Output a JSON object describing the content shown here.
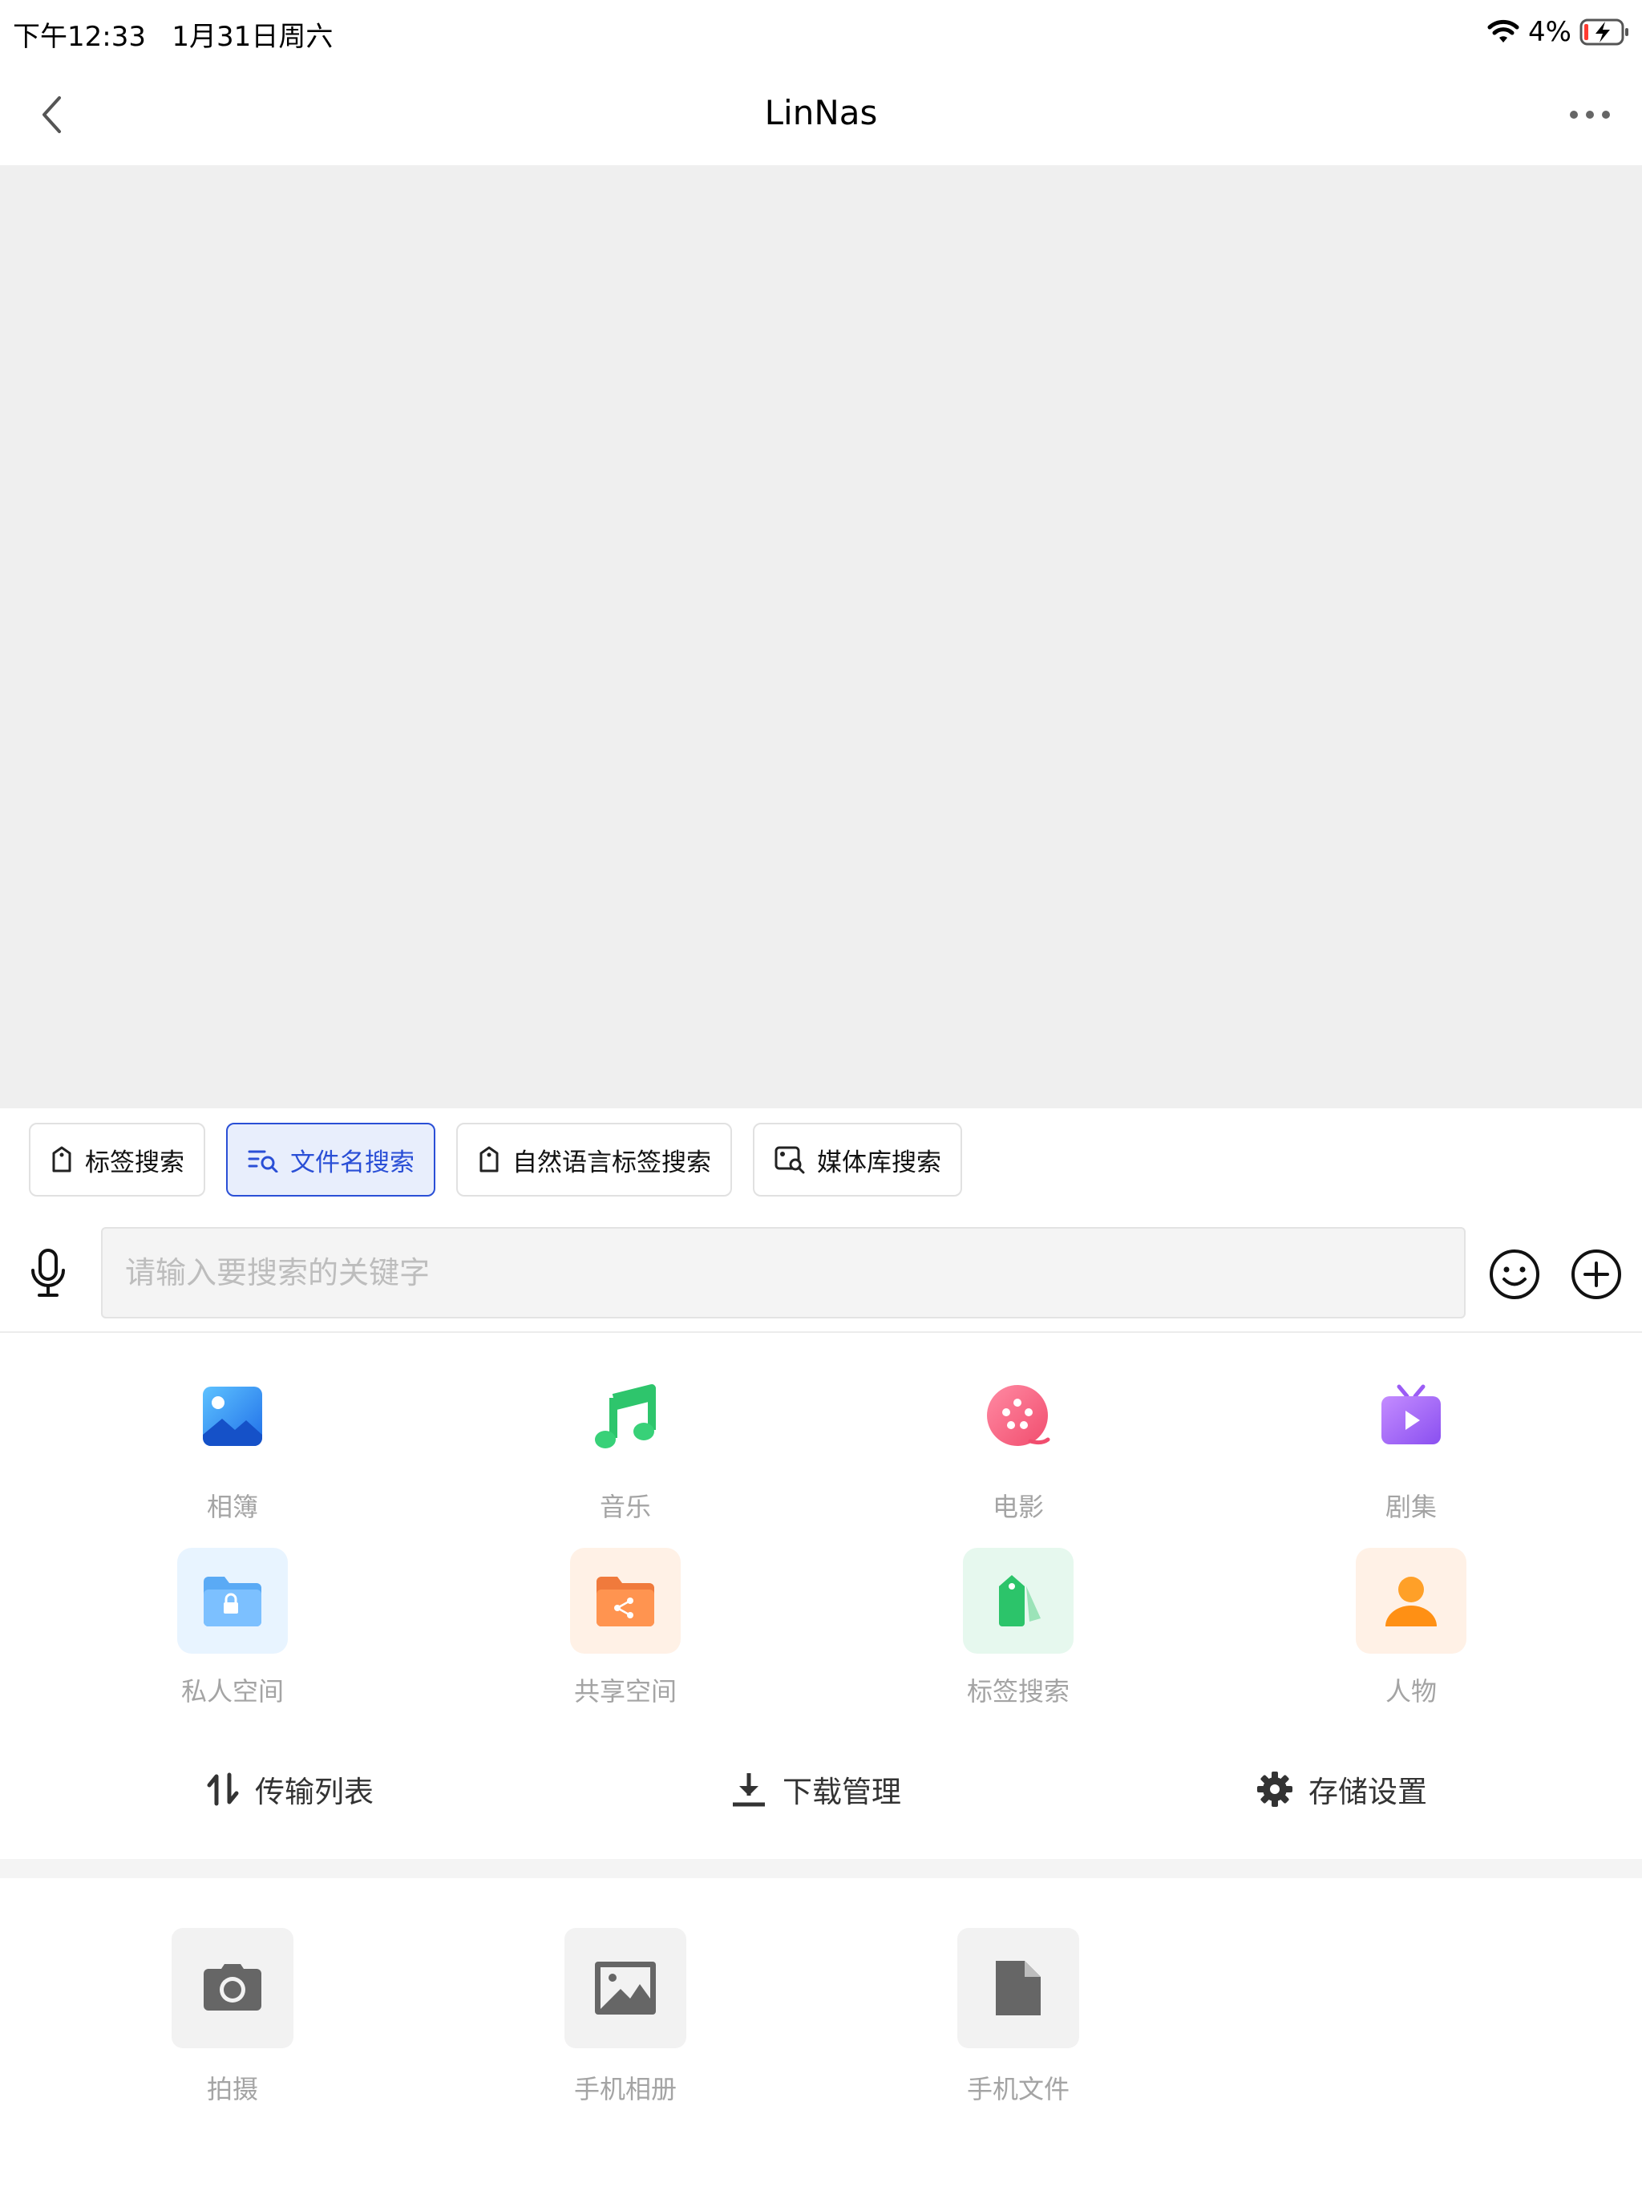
{
  "status_bar": {
    "time": "下午12:33",
    "date": "1月31日周六",
    "battery": "4%",
    "icons": [
      "wifi-icon",
      "battery-charging-icon"
    ]
  },
  "nav": {
    "title": "LinNas",
    "back_icon": "chevron-left-icon",
    "more_icon": "more-dots-icon"
  },
  "search_tabs": [
    {
      "label": "标签搜索",
      "icon": "tag-icon",
      "active": false
    },
    {
      "label": "文件名搜索",
      "icon": "file-search-icon",
      "active": true
    },
    {
      "label": "自然语言标签搜索",
      "icon": "tag-icon",
      "active": false
    },
    {
      "label": "媒体库搜索",
      "icon": "image-search-icon",
      "active": false
    }
  ],
  "input": {
    "placeholder": "请输入要搜索的关键字",
    "value": ""
  },
  "grid": [
    {
      "label": "相簿",
      "icon": "photo-album-icon"
    },
    {
      "label": "音乐",
      "icon": "music-note-icon"
    },
    {
      "label": "电影",
      "icon": "film-reel-icon"
    },
    {
      "label": "剧集",
      "icon": "tv-series-icon"
    },
    {
      "label": "私人空间",
      "icon": "locked-folder-icon"
    },
    {
      "label": "共享空间",
      "icon": "shared-folder-icon"
    },
    {
      "label": "标签搜索",
      "icon": "tag-icon"
    },
    {
      "label": "人物",
      "icon": "person-icon"
    }
  ],
  "quick_links": [
    {
      "label": "传输列表",
      "icon": "transfer-icon"
    },
    {
      "label": "下载管理",
      "icon": "download-icon"
    },
    {
      "label": "存储设置",
      "icon": "gear-icon"
    }
  ],
  "attachments": [
    {
      "label": "拍摄",
      "icon": "camera-icon"
    },
    {
      "label": "手机相册",
      "icon": "gallery-icon"
    },
    {
      "label": "手机文件",
      "icon": "file-icon"
    }
  ],
  "colors": {
    "accent": "#2a4fd6",
    "accent_bg": "#e8eefc",
    "content_bg": "#efefef",
    "label_gray": "#a4a4a4"
  }
}
